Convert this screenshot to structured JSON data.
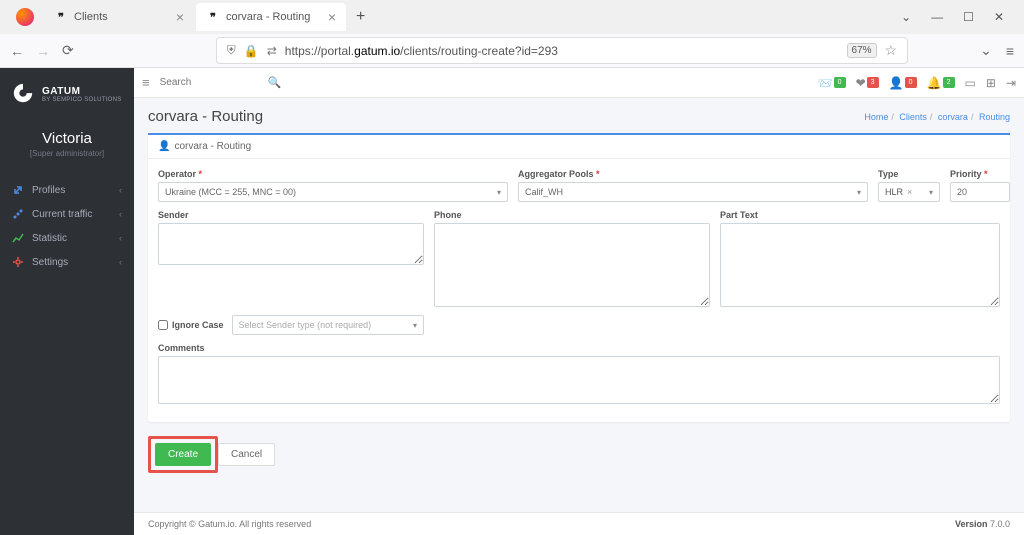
{
  "browser": {
    "tabs": [
      {
        "title": "Clients",
        "active": false
      },
      {
        "title": "corvara - Routing",
        "active": true
      }
    ],
    "url_prefix": "https://portal.",
    "url_domain": "gatum.io",
    "url_path": "/clients/routing-create?id=293",
    "zoom": "67%"
  },
  "brand": {
    "name": "GATUM",
    "sub": "BY SEMPICO SOLUTIONS"
  },
  "user": {
    "name": "Victoria",
    "role": "[Super administrator]"
  },
  "sidebar": {
    "items": [
      {
        "label": "Profiles",
        "icon": "link",
        "color": "#4a8de6"
      },
      {
        "label": "Current traffic",
        "icon": "signal",
        "color": "#4a8de6"
      },
      {
        "label": "Statistic",
        "icon": "chart",
        "color": "#3fb950"
      },
      {
        "label": "Settings",
        "icon": "gear",
        "color": "#e5534b"
      }
    ]
  },
  "topbar": {
    "search_placeholder": "Search",
    "badges": [
      {
        "icon": "inbox",
        "count": "0",
        "color": "green"
      },
      {
        "icon": "heart",
        "count": "3",
        "color": "red"
      },
      {
        "icon": "user",
        "count": "0",
        "color": "red"
      },
      {
        "icon": "bell",
        "count": "2",
        "color": "green"
      }
    ]
  },
  "page": {
    "title": "corvara - Routing",
    "crumbs": [
      "Home",
      "Clients",
      "corvara",
      "Routing"
    ],
    "card_title": "corvara - Routing"
  },
  "form": {
    "operator": {
      "label": "Operator",
      "value": "Ukraine (MCC = 255, MNC = 00)"
    },
    "aggregator": {
      "label": "Aggregator Pools",
      "value": "Calif_WH"
    },
    "type": {
      "label": "Type",
      "value": "HLR"
    },
    "priority": {
      "label": "Priority",
      "value": "20"
    },
    "sender": {
      "label": "Sender",
      "value": ""
    },
    "phone": {
      "label": "Phone",
      "value": ""
    },
    "part_text": {
      "label": "Part Text",
      "value": ""
    },
    "ignore_case": {
      "label": "Ignore Case",
      "checked": false
    },
    "sender_type": {
      "placeholder": "Select Sender type (not required)"
    },
    "comments": {
      "label": "Comments",
      "value": ""
    }
  },
  "actions": {
    "create": "Create",
    "cancel": "Cancel"
  },
  "footer": {
    "copyright": "Copyright © Gatum.io. All rights reserved",
    "version_label": "Version",
    "version": "7.0.0"
  }
}
